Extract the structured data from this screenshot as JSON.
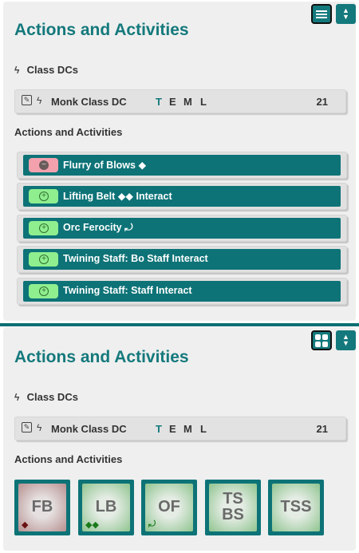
{
  "colors": {
    "accent": "#14797c",
    "action_bg": "#0d7377",
    "free_pill": "#f3a1ad",
    "action_pill": "#8fef8f"
  },
  "top_panel": {
    "title": "Actions and Activities",
    "view_toggle_icon": "list-view-icon",
    "sort_icon": "sort-icon",
    "class_dcs_label": "Class DCs",
    "dc_row": {
      "name": "Monk Class DC",
      "prof": [
        "T",
        "E",
        "M",
        "L"
      ],
      "value": "21"
    },
    "actions_label": "Actions and Activities",
    "actions": [
      {
        "name": "Flurry of Blows",
        "glyph": "◆",
        "pill": "pink",
        "pill_icon": "minus-circle-icon"
      },
      {
        "name": "Lifting Belt",
        "glyph": "◆◆",
        "suffix": "Interact",
        "pill": "green",
        "pill_icon": "plus-circle-icon"
      },
      {
        "name": "Orc Ferocity",
        "glyph": "⤾",
        "pill": "green",
        "pill_icon": "plus-circle-icon"
      },
      {
        "name": "Twining Staff: Bo Staff Interact",
        "pill": "green",
        "pill_icon": "plus-circle-icon"
      },
      {
        "name": "Twining Staff: Staff Interact",
        "pill": "green",
        "pill_icon": "plus-circle-icon"
      }
    ]
  },
  "bottom_panel": {
    "title": "Actions and Activities",
    "view_toggle_icon": "grid-view-icon",
    "sort_icon": "sort-icon",
    "class_dcs_label": "Class DCs",
    "dc_row": {
      "name": "Monk Class DC",
      "prof": [
        "T",
        "E",
        "M",
        "L"
      ],
      "value": "21"
    },
    "actions_label": "Actions and Activities",
    "tiles": [
      {
        "line1": "FB",
        "line2": "",
        "glyph": "◆",
        "glyph_color": "#6a1212",
        "face": "red"
      },
      {
        "line1": "LB",
        "line2": "",
        "glyph": "◆◆",
        "glyph_color": "#1b7a1b",
        "face": "green"
      },
      {
        "line1": "OF",
        "line2": "",
        "glyph": "⤾",
        "glyph_color": "#1b7a1b",
        "face": "green"
      },
      {
        "line1": "TS",
        "line2": "BS",
        "glyph": "",
        "glyph_color": "#1b7a1b",
        "face": "green"
      },
      {
        "line1": "TSS",
        "line2": "",
        "glyph": "",
        "glyph_color": "#1b7a1b",
        "face": "green"
      }
    ]
  }
}
